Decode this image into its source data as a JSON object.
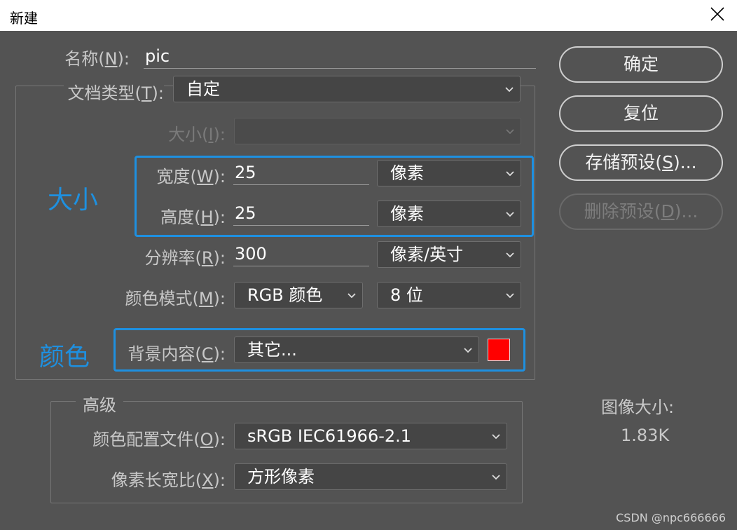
{
  "window": {
    "title": "新建"
  },
  "annotations": {
    "size": "大小",
    "color": "颜色"
  },
  "fields": {
    "name": {
      "label": "名称",
      "key": "N",
      "value": "pic"
    },
    "doc_type": {
      "label": "文档类型",
      "key": "T",
      "value": "自定"
    },
    "size": {
      "label": "大小",
      "key": "I",
      "value": ""
    },
    "width": {
      "label": "宽度",
      "key": "W",
      "value": "25",
      "unit": "像素"
    },
    "height": {
      "label": "高度",
      "key": "H",
      "value": "25",
      "unit": "像素"
    },
    "resolution": {
      "label": "分辨率",
      "key": "R",
      "value": "300",
      "unit": "像素/英寸"
    },
    "color_mode": {
      "label": "颜色模式",
      "key": "M",
      "value": "RGB 颜色",
      "depth": "8 位"
    },
    "background": {
      "label": "背景内容",
      "key": "C",
      "value": "其它...",
      "color": "#ff0000"
    }
  },
  "advanced": {
    "title": "高级",
    "color_profile": {
      "label": "颜色配置文件",
      "key": "O",
      "value": "sRGB IEC61966-2.1"
    },
    "pixel_aspect": {
      "label": "像素长宽比",
      "key": "X",
      "value": "方形像素"
    }
  },
  "buttons": {
    "ok": "确定",
    "reset": "复位",
    "save_preset": {
      "text": "存储预设",
      "key": "S",
      "suffix": "..."
    },
    "delete_preset": {
      "text": "删除预设",
      "key": "D",
      "suffix": "..."
    }
  },
  "image_size": {
    "label": "图像大小:",
    "value": "1.83K"
  },
  "watermark": "CSDN @npc666666"
}
